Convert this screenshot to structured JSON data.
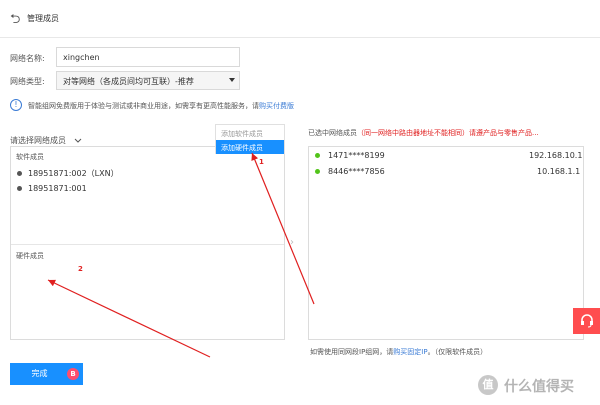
{
  "header": {
    "back_icon": "⮌",
    "title": "管理成员"
  },
  "form": {
    "name_label": "网络名称:",
    "name_value": "xingchen",
    "type_label": "网络类型:",
    "type_value": "对等网络（各成员间均可互联）-推荐"
  },
  "notice": {
    "icon": "!",
    "text": "智能组网免费版用于体验与测试或非商业用途，如需享有更高性能服务，请",
    "link": "购买付费版"
  },
  "left": {
    "title": "请选择网络成员",
    "software_title": "软件成员",
    "software_members": [
      "18951871:002（LXN）",
      "18951871:001"
    ],
    "hardware_title": "硬件成员"
  },
  "dropdown": {
    "items": [
      "添加软件成员",
      "添加硬件成员"
    ]
  },
  "right": {
    "title": "已选中网络成员",
    "warning": "（同一网络中路由器地址不能相同）请遵产品与零售产品...",
    "members": [
      {
        "id": "1471****8199",
        "ip": "192.168.10.1"
      },
      {
        "id": "8446****7856",
        "ip": "10.168.1.1"
      }
    ]
  },
  "footer": {
    "note_prefix": "如需使用同网段IP组网，请",
    "note_link": "购买固定IP",
    "note_suffix": "。（仅限软件成员）"
  },
  "buttons": {
    "done": "完成",
    "done_badge": "B"
  },
  "annotations": {
    "one": "1",
    "two": "2"
  },
  "watermark": {
    "badge": "值",
    "text": "什么值得买"
  },
  "colors": {
    "primary": "#1890ff",
    "link": "#3a7bd5",
    "danger": "#e02020",
    "online": "#52c41a"
  }
}
